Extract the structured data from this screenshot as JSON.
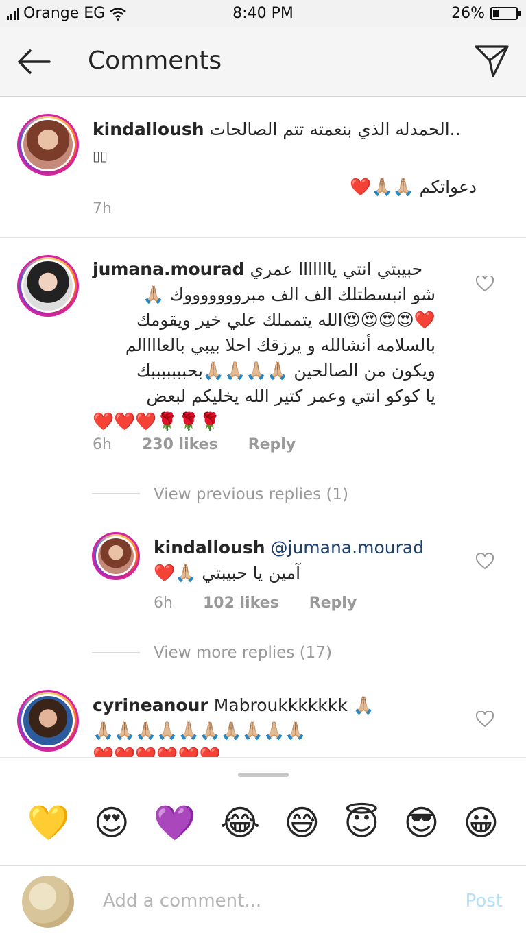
{
  "status": {
    "carrier": "Orange EG",
    "time": "8:40 PM",
    "battery": "26%",
    "battery_level": 0.26
  },
  "header": {
    "title": "Comments"
  },
  "caption": {
    "user": "kindalloush",
    "text": "الحمدله الذي بنعمته تتم الصالحات..",
    "text2": "دعواتكم 🙏🏼🙏🏼❤️",
    "time": "7h"
  },
  "comment1": {
    "user": "jumana.mourad",
    "lines": [
      "حبيبتي انتي يااااااا عمري",
      "شو انبسطتلك الف الف مبروووووووك 🙏🏼",
      "❤️😍😍😍😍الله يتمملك علي خير ويقومك",
      "بالسلامه أنشالله و يرزقك احلا بيبي بالعاااالم",
      "ويكون من الصالحين 🙏🏼🙏🏼🙏🏼🙏🏼بحبببببببك",
      "يا كوكو انتي وعمر كتير الله يخليكم لبعض",
      "❤️❤️❤️🌹🌹🌹"
    ],
    "time": "6h",
    "likes": "230 likes",
    "reply": "Reply"
  },
  "view_previous": "View previous replies (1)",
  "reply1": {
    "user": "kindalloush",
    "mention": "@jumana.mourad",
    "text": "آمين يا حبيبتي 🙏🏼❤️",
    "time": "6h",
    "likes": "102 likes",
    "reply": "Reply"
  },
  "view_more": "View more replies (17)",
  "comment2": {
    "user": "cyrineanour",
    "text": "Mabroukkkkkkk 🙏🏼",
    "line2": "🙏🏼🙏🏼🙏🏼🙏🏼🙏🏼🙏🏼🙏🏼🙏🏼🙏🏼🙏🏼",
    "line3": "❤️❤️❤️❤️❤️❤️"
  },
  "quick_emojis": [
    "💛",
    "😍",
    "💜",
    "😂",
    "😅",
    "😇",
    "😎",
    "😀"
  ],
  "composer": {
    "placeholder": "Add a comment...",
    "post": "Post"
  }
}
